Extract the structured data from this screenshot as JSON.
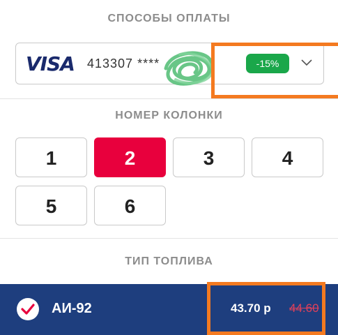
{
  "payment": {
    "title": "СПОСОБЫ ОПЛАТЫ",
    "card_brand": "VISA",
    "card_number": "413307 ****",
    "discount": "-15%",
    "brand_color": "#1a2a6c",
    "discount_color": "#1aa74a"
  },
  "pumps": {
    "title": "НОМЕР КОЛОНКИ",
    "selected": "2",
    "selected_color": "#e8003d",
    "items": [
      "1",
      "2",
      "3",
      "4",
      "5",
      "6"
    ]
  },
  "fuel": {
    "title": "ТИП ТОПЛИВА",
    "row_color": "#1e3e7e",
    "items": [
      {
        "name": "АИ-92",
        "price": "43.70 р",
        "old_price": "44.60",
        "selected": true
      }
    ]
  },
  "annotations": {
    "highlight_color": "#f47a20"
  }
}
